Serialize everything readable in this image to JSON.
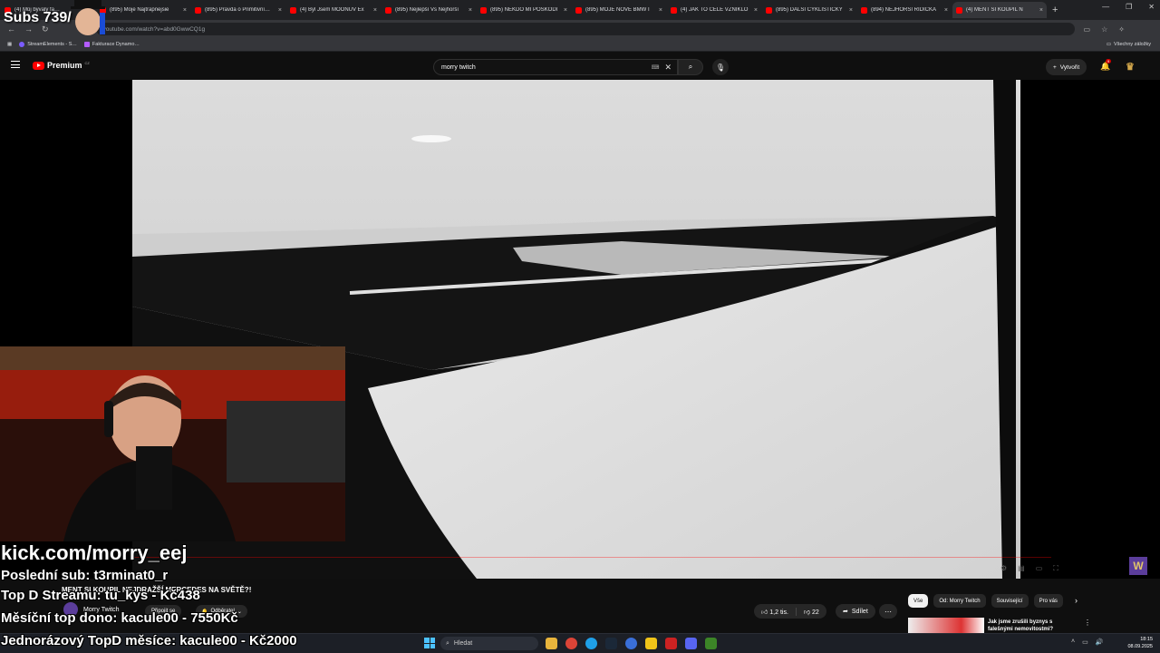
{
  "browser": {
    "tabs": [
      {
        "label": "(4) Můj bývalý fa…",
        "active": false
      },
      {
        "label": "(895) Moje Najtrapnejsie",
        "active": false
      },
      {
        "label": "(895) Pravda o Primitivní…",
        "active": false
      },
      {
        "label": "(4) Byl Jsem MOONŮV Ex",
        "active": false
      },
      {
        "label": "(895) Nejlepší Vs Nejhorší",
        "active": false
      },
      {
        "label": "(895) NĚKDO MI POŠKODI",
        "active": false
      },
      {
        "label": "(895) MOJE NOVÉ BMW I",
        "active": false
      },
      {
        "label": "(4) JAK TO CELÉ VZNIKLO",
        "active": false
      },
      {
        "label": "(895) DALŠÍ CYKLISTICKÝ",
        "active": false
      },
      {
        "label": "(894) NEJHORŠÍ ŘIDIČKA",
        "active": false
      },
      {
        "label": "(4) MENT SI KOUPIL N",
        "active": true
      }
    ],
    "tab_close_glyph": "×",
    "new_tab_glyph": "+",
    "window_controls": [
      "—",
      "❐",
      "✕"
    ],
    "nav_glyphs": [
      "←",
      "→",
      "↻"
    ],
    "url": "youtube.com/watch?v=abd0GwwCQ1g",
    "bookmarks": {
      "left": [
        "StreamElements - S…",
        "Fakturace Dynamo…"
      ],
      "right": "Všechny záložky"
    }
  },
  "youtube": {
    "logo_text": "Premium",
    "logo_region": "CZ",
    "search_value": "morry twitch",
    "create_label": "Vytvořit",
    "notification_count": "9",
    "video_title": "MENT SI KOUPIL NEJDRAŽŠÍ MERCEDES NA SVĚTĚ?!",
    "channel_name": "Morry Twitch",
    "join_label": "Připojit se",
    "subscribe_label": "Odběratel",
    "likes": "1,2 tis.",
    "dislikes": "22",
    "share_label": "Sdílet",
    "chips": [
      "Vše",
      "Od: Morry Twitch",
      "Související",
      "Pro vás"
    ],
    "recommendation_title": "Jak jsme zrušili byznys s falešnými nemovitostmi?",
    "corner_logo_glyph": "W"
  },
  "stream_overlay": {
    "subs": "Subs 739/",
    "kick": "kick.com/morry_eej",
    "last_sub": "Poslední sub: t3rminat0_r",
    "top_donor": "Top D Streamu: tu_kys - Kč438",
    "monthly_top": "Měsíční top dono: kacule00 - 7550Kč",
    "single_top": "Jednorázový TopD měsíce: kacule00 - Kč2000"
  },
  "taskbar": {
    "search_placeholder": "Hledat",
    "time": "18:15",
    "date": "08.09.2025"
  },
  "colors": {
    "youtube_red": "#ff0000",
    "background": "#0f0f0f",
    "channel_purple": "#5b3d9b",
    "gold": "#d4a84b"
  }
}
